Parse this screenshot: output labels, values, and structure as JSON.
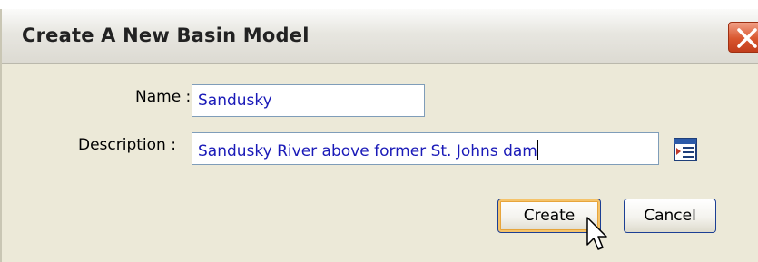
{
  "dialog": {
    "title": "Create A New Basin Model"
  },
  "form": {
    "name_label": "Name :",
    "name_value": "Sandusky",
    "description_label": "Description :",
    "description_value": "Sandusky River above former St. Johns dam"
  },
  "buttons": {
    "create_label": "Create",
    "cancel_label": "Cancel"
  },
  "icons": {
    "close": "close-icon",
    "browse": "description-editor-icon",
    "cursor": "mouse-pointer-icon"
  },
  "colors": {
    "input_text": "#1a1ab8",
    "default_button_highlight": "#f5c36a",
    "close_button": "#d9562f"
  }
}
